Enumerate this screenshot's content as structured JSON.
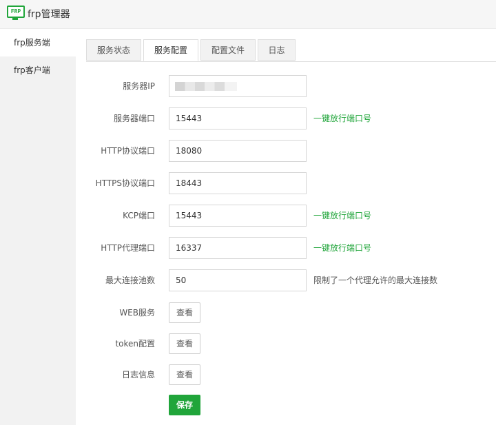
{
  "app": {
    "logo_text": "FRP",
    "title": "frp管理器"
  },
  "sidebar": {
    "items": [
      {
        "label": "frp服务端"
      },
      {
        "label": "frp客户端"
      }
    ]
  },
  "tabs": [
    {
      "label": "服务状态"
    },
    {
      "label": "服务配置"
    },
    {
      "label": "配置文件"
    },
    {
      "label": "日志"
    }
  ],
  "form": {
    "server_ip": {
      "label": "服务器IP",
      "value": ""
    },
    "server_port": {
      "label": "服务器端口",
      "value": "15443",
      "action": "一键放行端口号"
    },
    "http_port": {
      "label": "HTTP协议端口",
      "value": "18080"
    },
    "https_port": {
      "label": "HTTPS协议端口",
      "value": "18443"
    },
    "kcp_port": {
      "label": "KCP端口",
      "value": "15443",
      "action": "一键放行端口号"
    },
    "http_proxy_port": {
      "label": "HTTP代理端口",
      "value": "16337",
      "action": "一键放行端口号"
    },
    "max_pool": {
      "label": "最大连接池数",
      "value": "50",
      "hint": "限制了一个代理允许的最大连接数"
    },
    "web_service": {
      "label": "WEB服务",
      "button": "查看"
    },
    "token_config": {
      "label": "token配置",
      "button": "查看"
    },
    "log_info": {
      "label": "日志信息",
      "button": "查看"
    },
    "save_label": "保存"
  },
  "colors": {
    "accent": "#20a53a",
    "sidebar_bg": "#f2f2f2",
    "titlebar_bg": "#f6f6f6"
  },
  "icons": {
    "logo": "frp-monitor-icon"
  }
}
